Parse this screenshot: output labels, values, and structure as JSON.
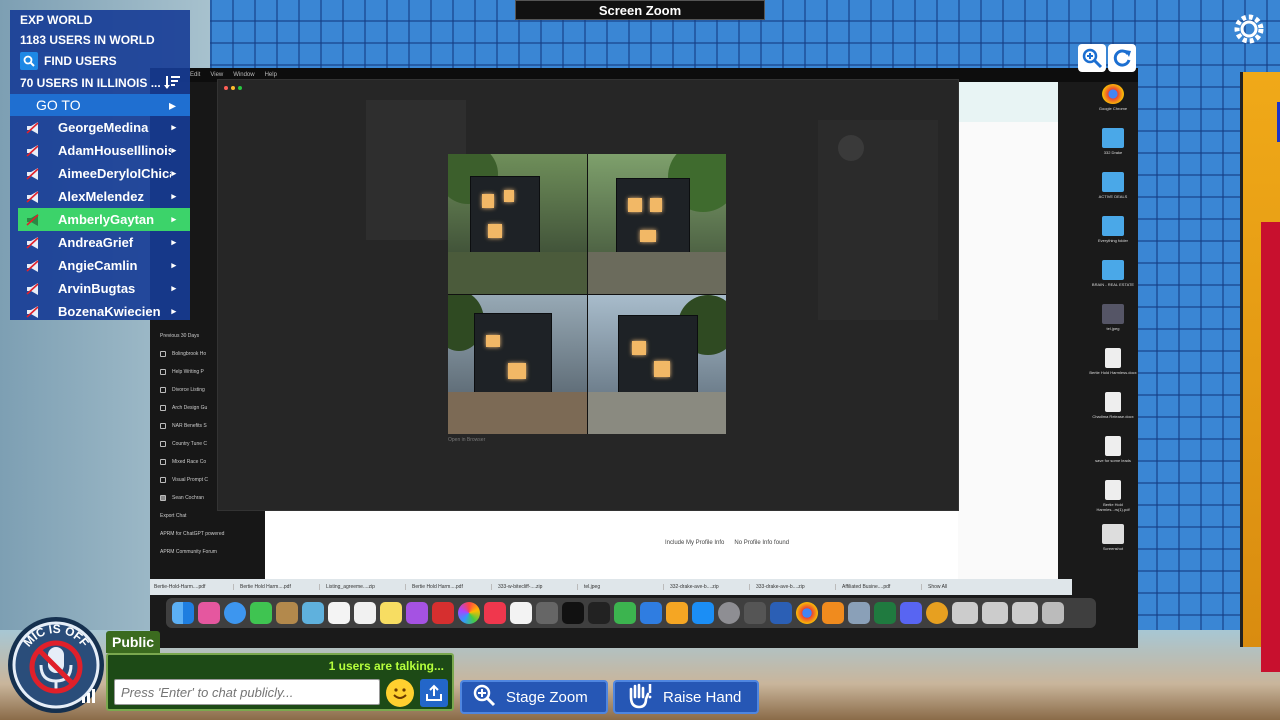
{
  "top_bar": {
    "title": "Screen Zoom"
  },
  "users_panel": {
    "world_name": "EXP WORLD",
    "users_in_world": "1183 USERS IN WORLD",
    "find_users": "FIND USERS",
    "users_in_state": "70 USERS IN ILLINOIS ...",
    "goto_label": "GO TO",
    "users": [
      {
        "name": "GeorgeMedina",
        "active": false
      },
      {
        "name": "AdamHouseIllinois",
        "active": false
      },
      {
        "name": "AimeeDeryloIChicago",
        "active": false
      },
      {
        "name": "AlexMelendez",
        "active": false
      },
      {
        "name": "AmberlyGaytan",
        "active": true
      },
      {
        "name": "AndreaGrief",
        "active": false
      },
      {
        "name": "AngieCamlin",
        "active": false
      },
      {
        "name": "ArvinBugtas",
        "active": false
      },
      {
        "name": "BozenaKwiecien",
        "active": false
      }
    ]
  },
  "shared_screen": {
    "open_in_browser": "Open in Browser",
    "include_profile": "Include My Profile Info",
    "no_profile": "No Profile Info found",
    "sidebar_items": [
      "Bolingbrook Ho",
      "Help Writing P",
      "Divorce Listing",
      "Arch Design Gu",
      "NAR Benefits S",
      "Country Tune C",
      "Mixed Race Co",
      "Visual Prompt C",
      "Sean Cochran"
    ],
    "sidebar_footer": [
      "Export Chat",
      "APRM for ChatGPT powered",
      "APRM Community Forum"
    ],
    "sidebar_section": "Previous 30 Days",
    "desktop_icons": [
      "Google Chrome",
      "332 Drake",
      "ACTIVE DEALS",
      "Everything folder",
      "BRAIN - REAL ESTATE",
      "tel.jpeg",
      "Bertie Hold Harmless.docx",
      "Chadima Release.docx",
      "save for some leads",
      "Bertie Hold Harmles...rs(1).pdf",
      "Screenshot"
    ],
    "downloads": [
      "Bertie-Hold-Harm....pdf",
      "Bertie Hold Harm....pdf",
      "Listing_agreeme....zip",
      "Bertie Hold Harm....pdf",
      "333-w-bitecliff-....zip",
      "tel.jpeg",
      "332-drake-ave-b....zip",
      "333-drake-ave-b....zip",
      "Affiliated Busine....pdf"
    ],
    "show_all": "Show All"
  },
  "chat": {
    "tab_label": "Public",
    "talking_status": "1 users are talking...",
    "placeholder": "Press 'Enter' to chat publicly..."
  },
  "mic_status": "MIC IS OFF",
  "buttons": {
    "stage_zoom": "Stage Zoom",
    "raise_hand": "Raise Hand"
  }
}
